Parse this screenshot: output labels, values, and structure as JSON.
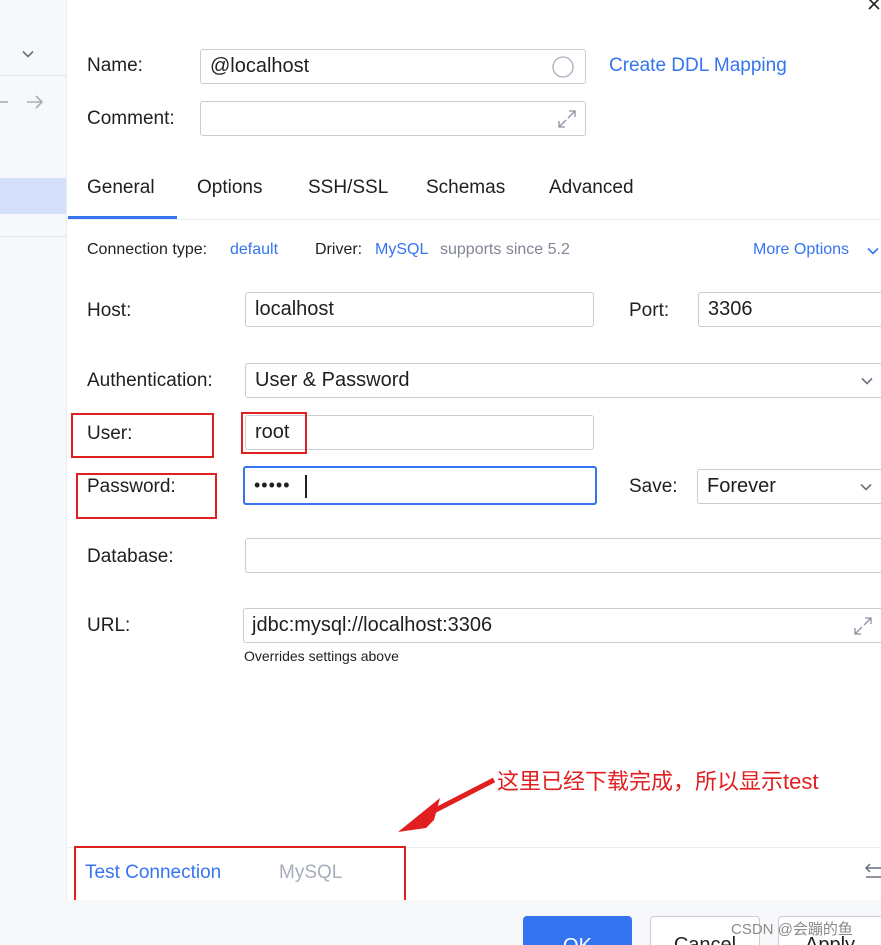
{
  "header": {
    "name_label": "Name:",
    "name_value": "@localhost",
    "create_ddl_link": "Create DDL Mapping",
    "comment_label": "Comment:",
    "comment_value": ""
  },
  "tabs": [
    {
      "label": "General",
      "active": true
    },
    {
      "label": "Options",
      "active": false
    },
    {
      "label": "SSH/SSL",
      "active": false
    },
    {
      "label": "Schemas",
      "active": false
    },
    {
      "label": "Advanced",
      "active": false
    }
  ],
  "general": {
    "connection_type_label": "Connection type:",
    "connection_type_value": "default",
    "driver_label": "Driver:",
    "driver_value": "MySQL",
    "driver_note": "supports since 5.2",
    "more_options": "More Options",
    "host_label": "Host:",
    "host_value": "localhost",
    "port_label": "Port:",
    "port_value": "3306",
    "auth_label": "Authentication:",
    "auth_value": "User & Password",
    "user_label": "User:",
    "user_value": "root",
    "password_label": "Password:",
    "password_value": "•••••",
    "save_label": "Save:",
    "save_value": "Forever",
    "database_label": "Database:",
    "database_value": "",
    "url_label": "URL:",
    "url_value": "jdbc:mysql://localhost:3306",
    "url_hint": "Overrides settings above"
  },
  "annotation": {
    "text": "这里已经下载完成，所以显示test",
    "color": "#e02020"
  },
  "footer": {
    "test_connection": "Test Connection",
    "driver_name": "MySQL",
    "ok": "OK",
    "cancel": "Cancel",
    "apply": "Apply",
    "watermark": "CSDN @会蹦的鱼"
  },
  "colors": {
    "accent": "#3574f0",
    "annotation_red": "#e02020",
    "selection": "#d5e1fb"
  }
}
